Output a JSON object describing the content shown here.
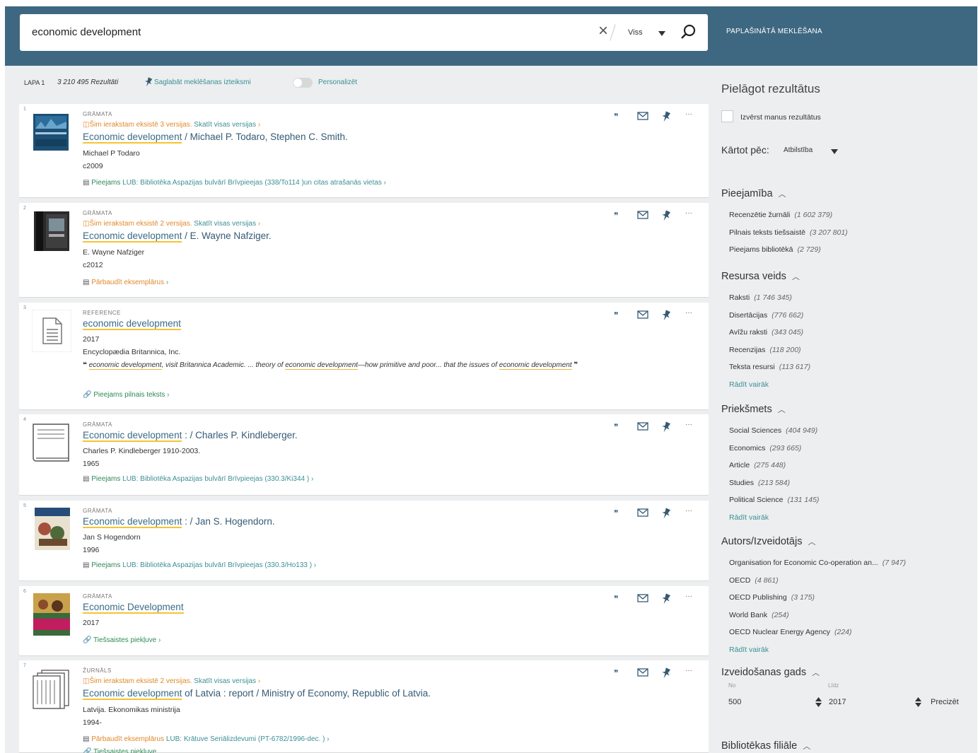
{
  "search": {
    "query": "economic development",
    "scope": "Viss",
    "advanced": "PAPLAŠINĀTĀ MEKLĒŠANA"
  },
  "toolbar": {
    "page": "LAPA 1",
    "count": "3 210 495 Rezultāti",
    "save": "Saglabāt meklēšanas izteiksmi",
    "personalize": "Personalizēt"
  },
  "results": [
    {
      "n": "1",
      "type": "GRĀMATA",
      "versions_a": "Šim ierakstam eksistē 3 versijas.",
      "versions_b": " Skatīt visas versijas",
      "title_hl": "Economic development",
      "title_rest": " / Michael P. Todaro, Stephen C. Smith.",
      "l1": "Michael P Todaro",
      "l2": "c2009",
      "avail_status": "Pieejams",
      "avail_lib": " LUB: Bibliotēka Aspazijas bulvārī  Brīvpieejas (338/To114 )un citas atrašanās vietas"
    },
    {
      "n": "2",
      "type": "GRĀMATA",
      "versions_a": "Šim ierakstam eksistē 2 versijas.",
      "versions_b": " Skatīt visas versijas",
      "title_hl": "Economic development",
      "title_rest": " / E. Wayne Nafziger.",
      "l1": "E. Wayne Nafziger",
      "l2": "c2012",
      "avail_status": "Pārbaudīt eksemplārus",
      "avail_lib": ""
    },
    {
      "n": "3",
      "type": "REFERENCE",
      "title_hl": "economic development",
      "title_rest": "",
      "l1": "2017",
      "l2": "Encyclopædia Britannica, Inc.",
      "snip_1": "economic development",
      "snip_2": ", visit Britannica Academic. ... theory of ",
      "snip_3": "economic development",
      "snip_4": "—how primitive and poor... that the issues of ",
      "snip_5": "economic development",
      "avail_status": "Pieejams pilnais teksts",
      "avail_lib": ""
    },
    {
      "n": "4",
      "type": "GRĀMATA",
      "title_hl": "Economic development",
      "title_rest": " : / Charles P. Kindleberger.",
      "l1": "Charles P. Kindleberger 1910-2003.",
      "l2": "1965",
      "avail_status": "Pieejams",
      "avail_lib": " LUB: Bibliotēka Aspazijas bulvārī  Brīvpieejas (330.3/Ki344 )"
    },
    {
      "n": "5",
      "type": "GRĀMATA",
      "title_hl": "Economic development",
      "title_rest": " : / Jan S. Hogendorn.",
      "l1": "Jan S Hogendorn",
      "l2": "1996",
      "avail_status": "Pieejams",
      "avail_lib": " LUB: Bibliotēka Aspazijas bulvārī  Brīvpieejas (330.3/Ho133 )"
    },
    {
      "n": "6",
      "type": "GRĀMATA",
      "title_hl": "Economic Development",
      "title_rest": "",
      "l1": "2017",
      "avail_status": "Tiešsaistes piekļuve",
      "avail_lib": ""
    },
    {
      "n": "7",
      "type": "ŽURNĀLS",
      "versions_a": "Šim ierakstam eksistē 2 versijas.",
      "versions_b": " Skatīt visas versijas",
      "title_hl": "Economic development",
      "title_rest": " of Latvia : report / Ministry of Economy, Republic of Latvia.",
      "l1": "Latvija. Ekonomikas ministrija",
      "l2": "1994-",
      "avail_status": "Pārbaudīt eksemplārus",
      "avail_lib": " LUB: Krātuve  Seriālizdevumi (PT-6782/1996-dec. )",
      "avail_extra": "Tiešsaistes piekļuve"
    }
  ],
  "sidebar": {
    "title": "Pielāgot rezultātus",
    "expand": "Izvērst manus rezultātus",
    "sort_label": "Kārtot pēc:",
    "sort_value": "Atbilstība",
    "show_more": "Rādīt vairāk",
    "facets": [
      {
        "name": "Pieejamība",
        "items": [
          {
            "l": "Recenzētie žurnāli",
            "c": "(1 602 379)"
          },
          {
            "l": "Pilnais teksts tiešsaistē",
            "c": "(3 207 801)"
          },
          {
            "l": "Pieejams bibliotēkā",
            "c": "(2 729)"
          }
        ]
      },
      {
        "name": "Resursa veids",
        "items": [
          {
            "l": "Raksti",
            "c": "(1 746 345)"
          },
          {
            "l": "Disertācijas",
            "c": "(776 662)"
          },
          {
            "l": "Avīžu raksti",
            "c": "(343 045)"
          },
          {
            "l": "Recenzijas",
            "c": "(118 200)"
          },
          {
            "l": "Teksta resursi",
            "c": "(113 617)"
          }
        ]
      },
      {
        "name": "Priekšmets",
        "items": [
          {
            "l": "Social Sciences",
            "c": "(404 949)"
          },
          {
            "l": "Economics",
            "c": "(293 665)"
          },
          {
            "l": "Article",
            "c": "(275 448)"
          },
          {
            "l": "Studies",
            "c": "(213 584)"
          },
          {
            "l": "Political Science",
            "c": "(131 145)"
          }
        ]
      },
      {
        "name": "Autors/Izveidotājs",
        "items": [
          {
            "l": "Organisation for Economic Co-operation an...",
            "c": "(7 947)"
          },
          {
            "l": "OECD",
            "c": "(4 861)"
          },
          {
            "l": "OECD Publishing",
            "c": "(3 175)"
          },
          {
            "l": "World Bank",
            "c": "(254)"
          },
          {
            "l": "OECD Nuclear Energy Agency",
            "c": "(224)"
          }
        ]
      }
    ],
    "year": {
      "title": "Izveidošanas gads",
      "from_label": "No",
      "to_label": "Līdz",
      "from": "500",
      "to": "2017",
      "apply": "Precizēt"
    },
    "branch": "Bibliotēkas filiāle"
  }
}
